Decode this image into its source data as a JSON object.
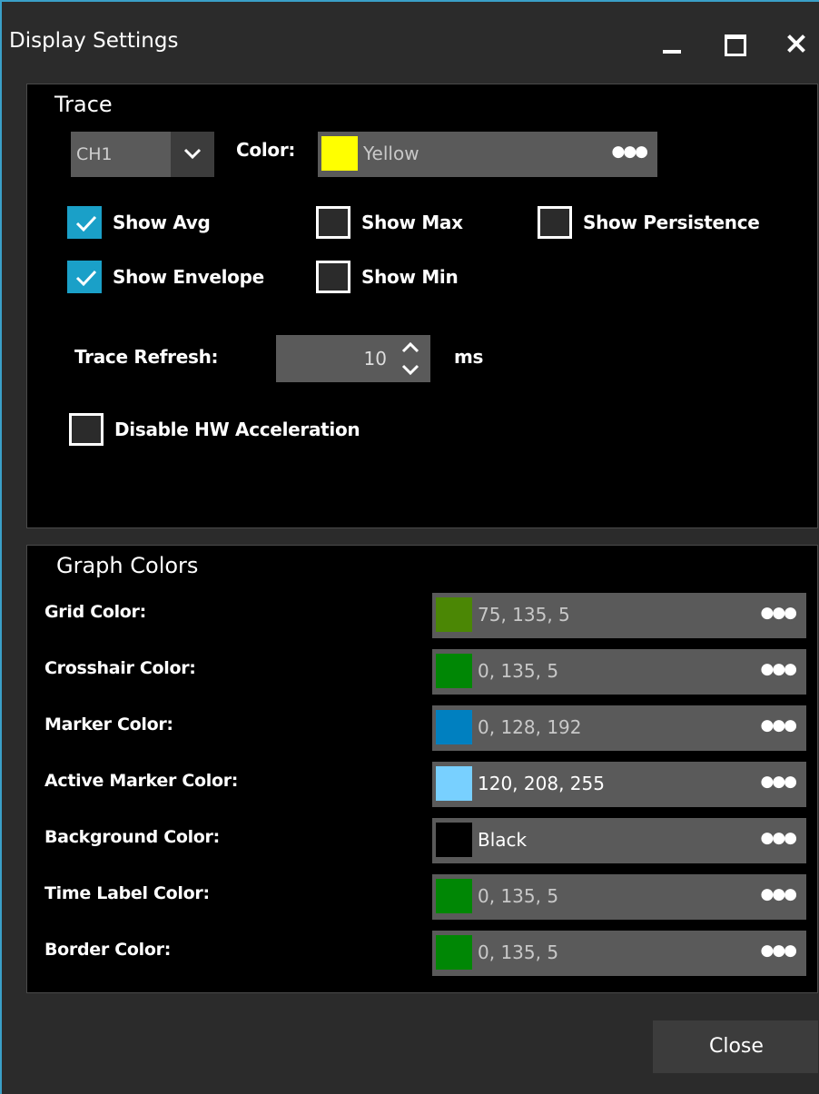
{
  "window": {
    "title": "Display Settings"
  },
  "trace": {
    "group_title": "Trace",
    "channel": "CH1",
    "color_label": "Color:",
    "color_value": "Yellow",
    "color_swatch": "#ffff00",
    "checkboxes": {
      "show_avg": {
        "label": "Show Avg",
        "checked": true
      },
      "show_max": {
        "label": "Show Max",
        "checked": false
      },
      "show_persistence": {
        "label": "Show Persistence",
        "checked": false
      },
      "show_envelope": {
        "label": "Show Envelope",
        "checked": true
      },
      "show_min": {
        "label": "Show Min",
        "checked": false
      },
      "disable_hw": {
        "label": "Disable HW Acceleration",
        "checked": false
      }
    },
    "refresh_label": "Trace Refresh:",
    "refresh_value": "10",
    "refresh_unit": "ms"
  },
  "graph_colors": {
    "group_title": "Graph Colors",
    "rows": [
      {
        "label": "Grid Color:",
        "value": "75, 135, 5",
        "swatch": "#4b8705"
      },
      {
        "label": "Crosshair Color:",
        "value": "0, 135, 5",
        "swatch": "#008705"
      },
      {
        "label": "Marker Color:",
        "value": "0, 128, 192",
        "swatch": "#0080c0"
      },
      {
        "label": "Active Marker Color:",
        "value": "120, 208, 255",
        "swatch": "#78d0ff"
      },
      {
        "label": "Background Color:",
        "value": "Black",
        "swatch": "#000000"
      },
      {
        "label": "Time Label Color:",
        "value": "0, 135, 5",
        "swatch": "#008705"
      },
      {
        "label": "Border Color:",
        "value": "0, 135, 5",
        "swatch": "#008705"
      }
    ]
  },
  "footer": {
    "close_label": "Close"
  },
  "colors": {
    "accent": "#1aa0c8",
    "window_border": "#3aa0c8",
    "field_bg": "#5a5a5a"
  }
}
